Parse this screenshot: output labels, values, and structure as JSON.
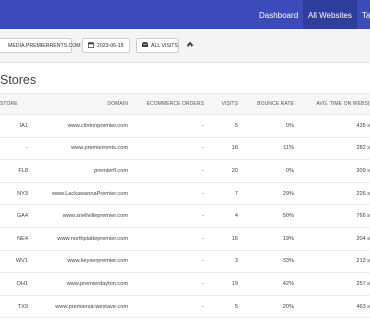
{
  "nav": {
    "items": [
      {
        "label": "Dashboard",
        "active": false
      },
      {
        "label": "All Websites",
        "active": true
      },
      {
        "label": "Ta",
        "active": false
      }
    ]
  },
  "toolbar": {
    "site_button": "MEDIA.PREMIERRENTS.COM",
    "date_button": "2023-06-18",
    "segment_button": "ALL VISITS"
  },
  "page_title": "Stores",
  "table": {
    "headers": {
      "store": "STORE",
      "domain": "DOMAIN",
      "ecommerce": "ECOMMERCE ORDERS",
      "visits": "VISITS",
      "bounce": "BOUNCE RATE",
      "avg_time": "AVG. TIME ON WEBSITE"
    },
    "rows": [
      {
        "store": "IA1",
        "domain": "www.clintonpremier.com",
        "ecommerce": "-",
        "visits": "5",
        "bounce": "0%",
        "avg_time": "435 sec"
      },
      {
        "store": "-",
        "domain": "www.premierrents.com",
        "ecommerce": "-",
        "visits": "18",
        "bounce": "11%",
        "avg_time": "282 sec"
      },
      {
        "store": "FL8",
        "domain": "premierfl.com",
        "ecommerce": "-",
        "visits": "20",
        "bounce": "0%",
        "avg_time": "309 sec"
      },
      {
        "store": "NY3",
        "domain": "www.LackawannaPremier.com",
        "ecommerce": "-",
        "visits": "7",
        "bounce": "29%",
        "avg_time": "226 sec"
      },
      {
        "store": "GA4",
        "domain": "www.snellvillepremier.com",
        "ecommerce": "-",
        "visits": "4",
        "bounce": "50%",
        "avg_time": "766 sec"
      },
      {
        "store": "NE4",
        "domain": "www.northplattepremier.com",
        "ecommerce": "-",
        "visits": "16",
        "bounce": "19%",
        "avg_time": "204 sec"
      },
      {
        "store": "WV1",
        "domain": "www.keyserpremier.com",
        "ecommerce": "-",
        "visits": "3",
        "bounce": "33%",
        "avg_time": "213 sec"
      },
      {
        "store": "OH1",
        "domain": "www.premierdayton.com",
        "ecommerce": "-",
        "visits": "19",
        "bounce": "42%",
        "avg_time": "257 sec"
      },
      {
        "store": "TX9",
        "domain": "www.premiersa-westave.com",
        "ecommerce": "-",
        "visits": "5",
        "bounce": "20%",
        "avg_time": "463 sec"
      }
    ]
  },
  "colors": {
    "navbar": "#3b4cb8",
    "navbar_active": "#2f3d9c"
  },
  "icons": [
    "calendar-icon",
    "segment-icon",
    "home-icon"
  ]
}
